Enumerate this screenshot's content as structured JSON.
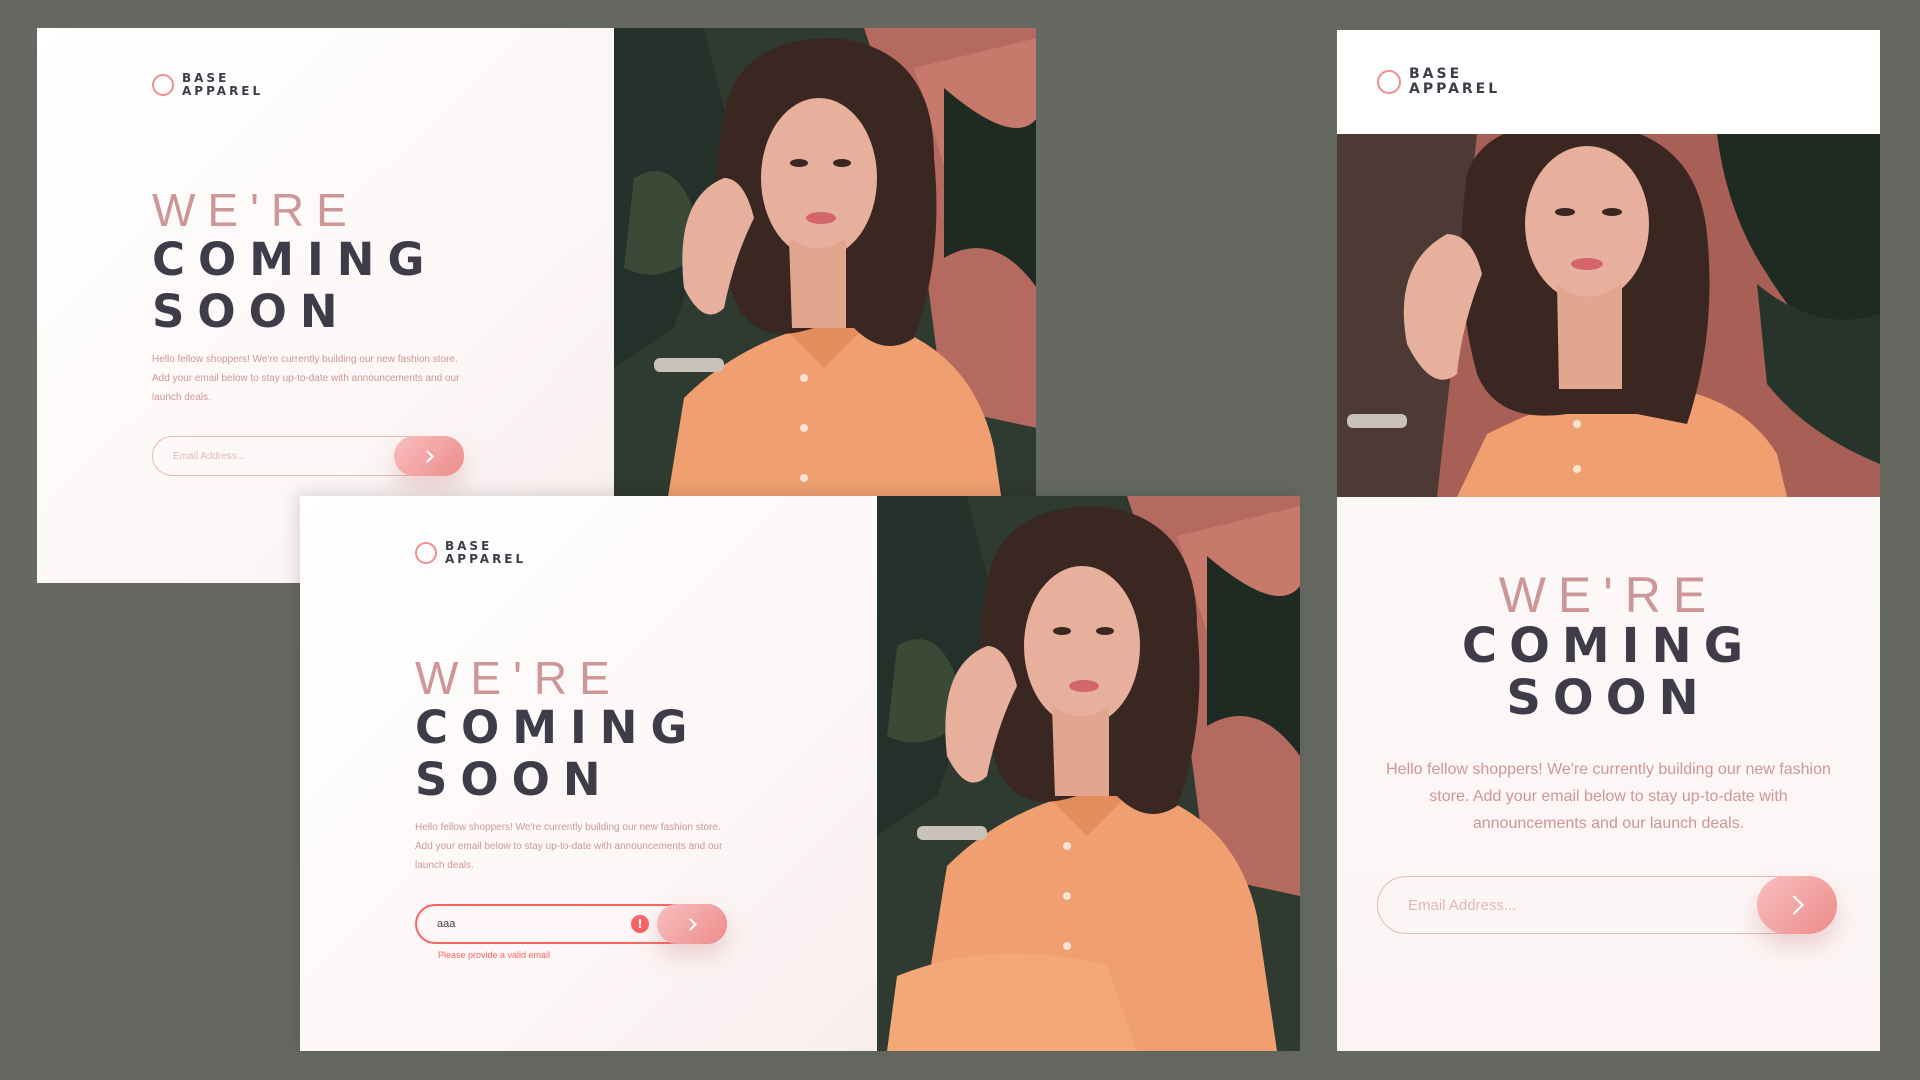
{
  "brand": {
    "line1": "BASE",
    "line2": "APPAREL"
  },
  "headline": {
    "light": "WE'RE",
    "line2": "COMING",
    "line3": "SOON"
  },
  "intro": "Hello fellow shoppers! We're currently building our new fashion store. Add your email below to stay up-to-date with announcements and our launch deals.",
  "form": {
    "placeholder": "Email Address...",
    "error_value": "aaa",
    "error_message": "Please provide a valid email",
    "error_icon": "!"
  },
  "icons": {
    "submit": "chevron-right-icon",
    "error": "error-icon",
    "logo": "circle-logo-icon"
  },
  "colors": {
    "accent": "#ce9797",
    "dark": "#3e3c49",
    "error": "#f96464",
    "button_from": "#f8bfbf",
    "button_to": "#ee8b8b",
    "backdrop": "#656962"
  }
}
